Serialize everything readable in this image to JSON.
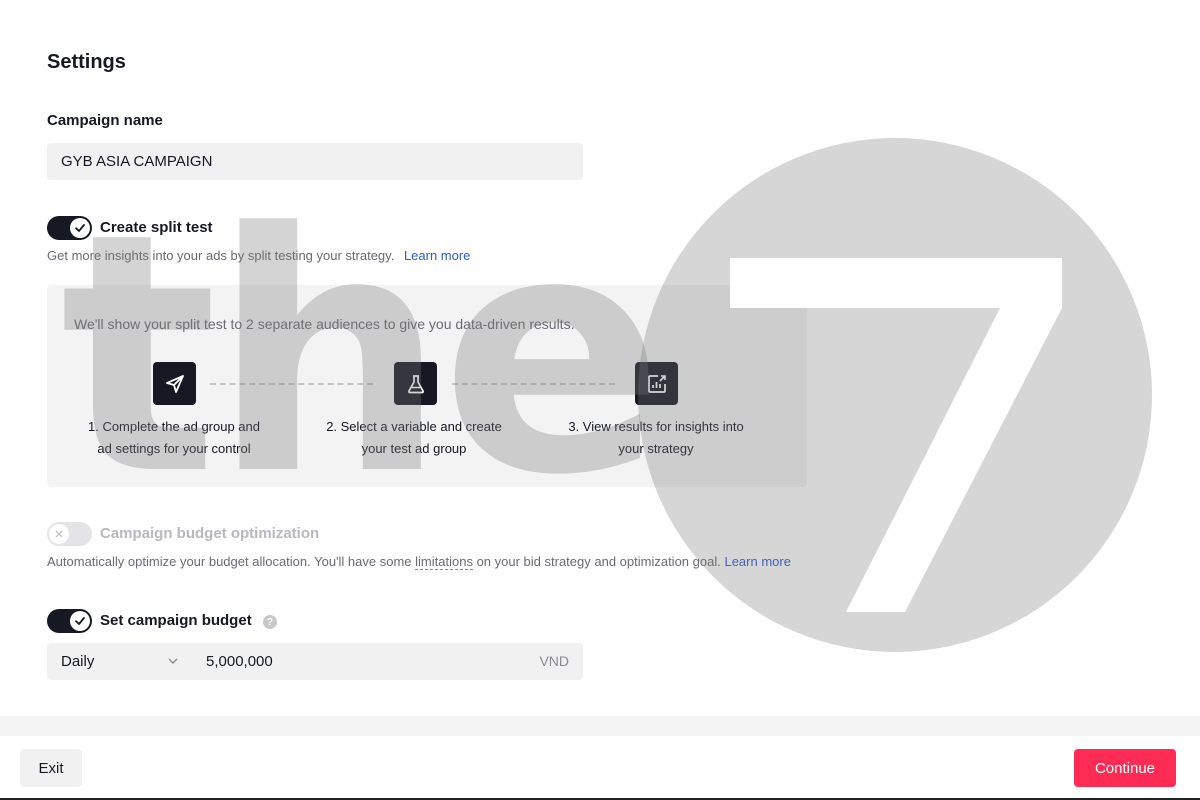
{
  "settings": {
    "heading": "Settings",
    "campaign_name_label": "Campaign name",
    "campaign_name_value": "GYB ASIA CAMPAIGN"
  },
  "split_test": {
    "label": "Create split test",
    "enabled": true,
    "description": "Get more insights into your ads by split testing your strategy.",
    "learn_more": "Learn more",
    "intro": "We'll show your split test to 2 separate audiences to give you data-driven results.",
    "steps": [
      {
        "icon": "send-icon",
        "line1": "1. Complete the ad group and",
        "line2": "ad settings for your control"
      },
      {
        "icon": "flask-icon",
        "line1": "2. Select a variable and create",
        "line2": "your test ad group"
      },
      {
        "icon": "chart-export-icon",
        "line1": "3. View results for insights into",
        "line2": "your strategy"
      }
    ]
  },
  "cbo": {
    "label": "Campaign budget optimization",
    "enabled": false,
    "description_pre": "Automatically optimize your budget allocation. You'll have some",
    "limitations": "limitations",
    "description_post": "on your bid strategy and optimization goal.",
    "learn_more": "Learn more"
  },
  "budget": {
    "label": "Set campaign budget",
    "enabled": true,
    "period": "Daily",
    "amount": "5,000,000",
    "currency": "VND"
  },
  "footer": {
    "exit": "Exit",
    "continue": "Continue"
  },
  "watermark": {
    "text": "the",
    "number": "7"
  },
  "colors": {
    "accent": "#fe2c55",
    "link": "#2a5ad6",
    "toggle_on": "#161823"
  }
}
